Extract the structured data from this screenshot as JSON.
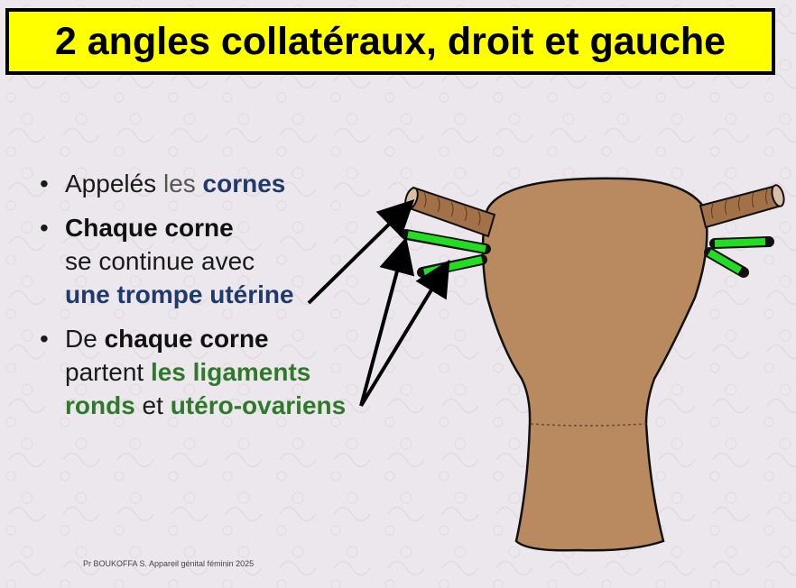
{
  "title": "2 angles collatéraux, droit et gauche",
  "bullets": [
    {
      "parts": [
        {
          "text": "Appelés ",
          "style": "normal"
        },
        {
          "text": "les ",
          "style": "normal"
        },
        {
          "text": "cornes",
          "style": "blue"
        }
      ]
    },
    {
      "lines": [
        [
          {
            "text": "Chaque corne",
            "style": "bold"
          }
        ],
        [
          {
            "text": "se continue avec",
            "style": "normal"
          }
        ],
        [
          {
            "text": "une trompe utérine",
            "style": "blue"
          }
        ]
      ]
    },
    {
      "lines": [
        [
          {
            "text": "De ",
            "style": "normal"
          },
          {
            "text": "chaque corne",
            "style": "bold"
          }
        ],
        [
          {
            "text": "partent ",
            "style": "normal"
          },
          {
            "text": "les ligaments",
            "style": "green"
          }
        ],
        [
          {
            "text": "ronds",
            "style": "green"
          },
          {
            "text": " et ",
            "style": "normal"
          },
          {
            "text": "utéro-ovariens",
            "style": "green"
          }
        ]
      ]
    }
  ],
  "footer": "Pr BOUKOFFA S. Appareil génital féminin 2025",
  "colors": {
    "title_bg": "#ffff00",
    "uterus_fill": "#b98a5f",
    "ligament_green": "#22dd22",
    "blue_text": "#1f3a6b",
    "green_text": "#2f7a2a"
  }
}
